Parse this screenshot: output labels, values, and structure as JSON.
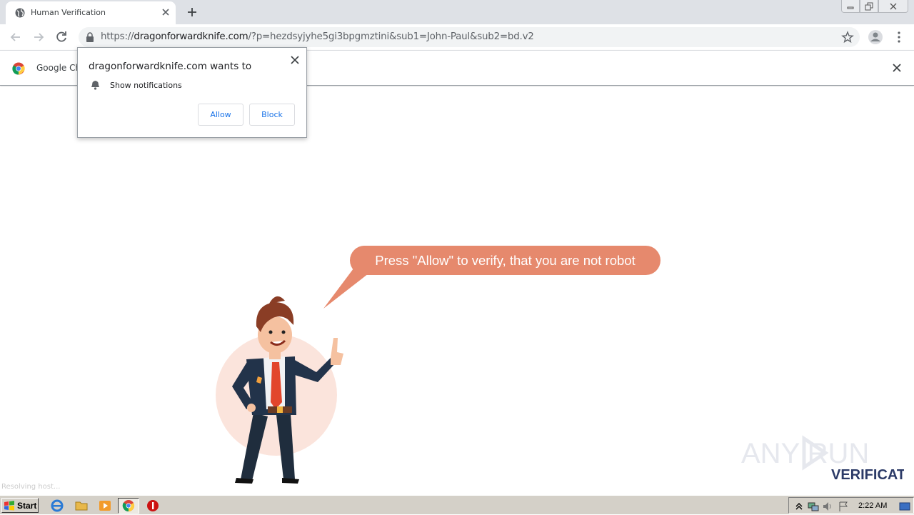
{
  "browser": {
    "tab": {
      "title": "Human Verification"
    },
    "window_controls": [
      "minimize",
      "restore",
      "close"
    ],
    "address": {
      "host_prefix": "https://",
      "host": "dragonforwardknife.com",
      "path": "/?p=hezdsyjyhe5gi3bpgmztini&sub1=John-Paul&sub2=bd.v2"
    },
    "infobar": {
      "text": "Google Ch"
    }
  },
  "permission_popup": {
    "heading": "dragonforwardknife.com wants to",
    "permission": "Show notifications",
    "allow_label": "Allow",
    "block_label": "Block"
  },
  "page": {
    "speech_bubble": "Press \"Allow\" to verify, that you are not robot",
    "watermark_top": "ANY RUN",
    "watermark_bottom": "VERIFICATION",
    "status_hint": "Resolving host..."
  },
  "taskbar": {
    "start_label": "Start",
    "clock": "2:22 AM",
    "apps": [
      "internet-explorer-icon",
      "folder-icon",
      "media-player-icon",
      "chrome-icon",
      "stop-icon"
    ]
  },
  "colors": {
    "bubble": "#e6896d",
    "watermark": "#2b3a67",
    "link_button": "#1a73e8"
  }
}
